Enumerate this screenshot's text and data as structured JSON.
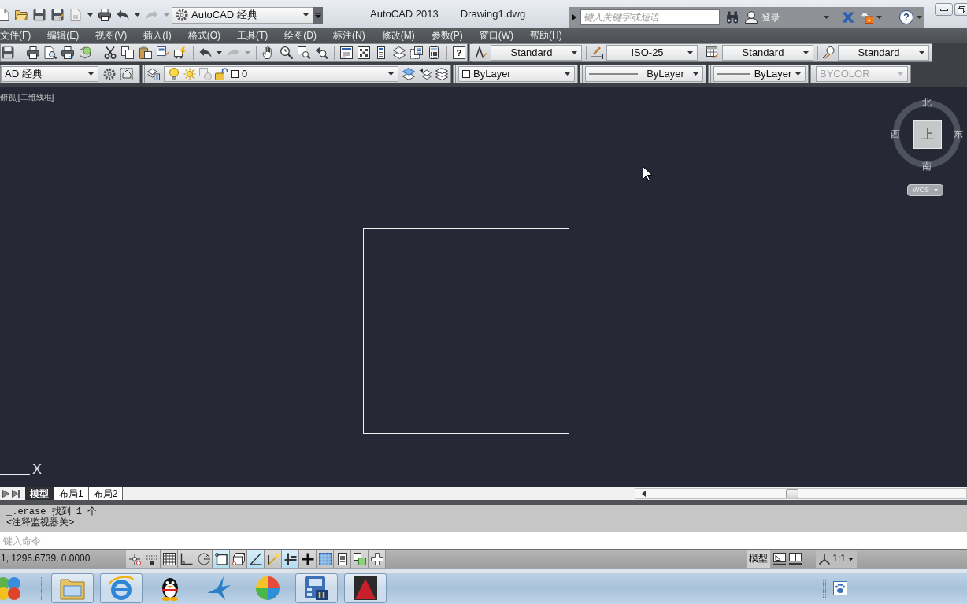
{
  "title_bar": {
    "workspace": "AutoCAD 经典",
    "app_name": "AutoCAD 2013",
    "document": "Drawing1.dwg",
    "search": {
      "placeholder": "键入关键字或短语"
    },
    "sign_in": "登录",
    "help": "?"
  },
  "menu_bar": [
    "文件(F)",
    "编辑(E)",
    "视图(V)",
    "插入(I)",
    "格式(O)",
    "工具(T)",
    "绘图(D)",
    "标注(N)",
    "修改(M)",
    "参数(P)",
    "窗口(W)",
    "帮助(H)"
  ],
  "standard_toolbar": {
    "help": "?",
    "text_style": "Standard",
    "dimension_style": "ISO-25",
    "table_style": "Standard",
    "multileader_style": "Standard"
  },
  "layers_toolbar": {
    "workspace": "AD 经典",
    "layer": "0",
    "color_control": "ByLayer",
    "linetype": "ByLayer",
    "lineweight": "ByLayer",
    "plot_style": {
      "value": "BYCOLOR",
      "disabled": true
    }
  },
  "viewport": {
    "label": "俯视][二维线框]",
    "viewcube": {
      "north": "北",
      "west": "西",
      "east": "东",
      "south": "南",
      "face": "上",
      "ucs_menu": "WCS"
    },
    "ucs_axis_label": "X"
  },
  "layout_tabs": [
    {
      "label": "模型",
      "selected": true
    },
    {
      "label": "布局1",
      "selected": false
    },
    {
      "label": "布局2",
      "selected": false
    }
  ],
  "command_line": {
    "history": [
      "_.erase 找到 1 个",
      "<注释监视器关>"
    ],
    "placeholder": "键入命令"
  },
  "status_bar": {
    "coordinates": "1, 1296.6739, 0.0000",
    "toggles": [
      {
        "kind": "infer",
        "on": false
      },
      {
        "kind": "snap",
        "on": false
      },
      {
        "kind": "grid",
        "on": false
      },
      {
        "kind": "ortho",
        "on": false
      },
      {
        "kind": "polar",
        "on": false
      },
      {
        "kind": "osnap",
        "on": true
      },
      {
        "kind": "osnap3d",
        "on": false
      },
      {
        "kind": "otrack",
        "on": true
      },
      {
        "kind": "ducs",
        "on": false
      },
      {
        "kind": "dyn",
        "on": true
      },
      {
        "kind": "lineweight",
        "on": false
      },
      {
        "kind": "transparency",
        "on": false
      },
      {
        "kind": "quickprops",
        "on": false
      },
      {
        "kind": "cycling",
        "on": false
      },
      {
        "kind": "monitor",
        "on": false
      }
    ],
    "space": "模型",
    "annotation_scale": "1:1"
  },
  "taskbar": {
    "items": [
      {
        "kind": "folder",
        "running": true
      },
      {
        "kind": "browser",
        "running": true
      },
      {
        "kind": "penguin",
        "running": false
      },
      {
        "kind": "bird",
        "running": false
      },
      {
        "kind": "ball",
        "running": false
      },
      {
        "kind": "media",
        "running": true
      },
      {
        "kind": "cad",
        "running": true
      }
    ]
  }
}
